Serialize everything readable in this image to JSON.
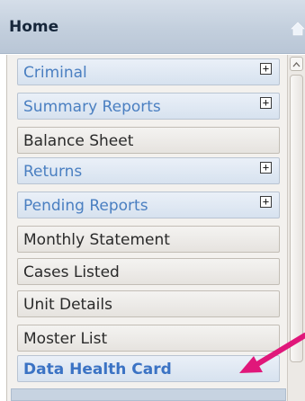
{
  "header": {
    "title": "Home",
    "icon": "home-icon"
  },
  "menu": {
    "items": [
      {
        "label": "Criminal",
        "style": "blue",
        "expandable": true
      },
      {
        "label": "Summary Reports",
        "style": "blue",
        "expandable": true
      },
      {
        "label": "Balance Sheet",
        "style": "dark",
        "expandable": false
      },
      {
        "label": "Returns",
        "style": "blue",
        "expandable": true
      },
      {
        "label": "Pending Reports",
        "style": "blue",
        "expandable": true
      },
      {
        "label": "Monthly Statement",
        "style": "dark",
        "expandable": false
      },
      {
        "label": "Cases Listed",
        "style": "dark",
        "expandable": false
      },
      {
        "label": "Unit Details",
        "style": "dark",
        "expandable": false
      },
      {
        "label": "Moster List",
        "style": "dark",
        "expandable": false
      },
      {
        "label": "Data Health Card",
        "style": "bold",
        "expandable": false
      }
    ],
    "expand_symbol": "+"
  },
  "annotation": {
    "arrow_color": "#e0177a"
  }
}
